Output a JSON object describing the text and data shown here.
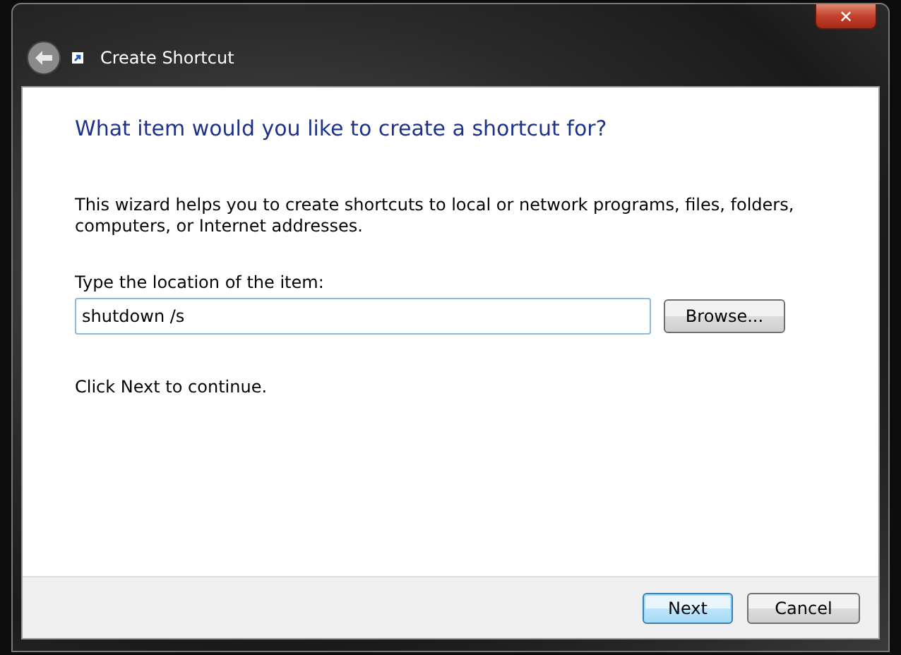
{
  "window": {
    "title": "Create Shortcut",
    "close": "✕"
  },
  "heading": "What item would you like to create a shortcut for?",
  "description": "This wizard helps you to create shortcuts to local or network programs, files, folders, computers, or Internet addresses.",
  "location": {
    "label": "Type the location of the item:",
    "value": "shutdown /s",
    "browse": "Browse..."
  },
  "hint": "Click Next to continue.",
  "buttons": [
    {
      "label": "Next",
      "default": true
    },
    {
      "label": "Cancel",
      "default": false
    }
  ]
}
